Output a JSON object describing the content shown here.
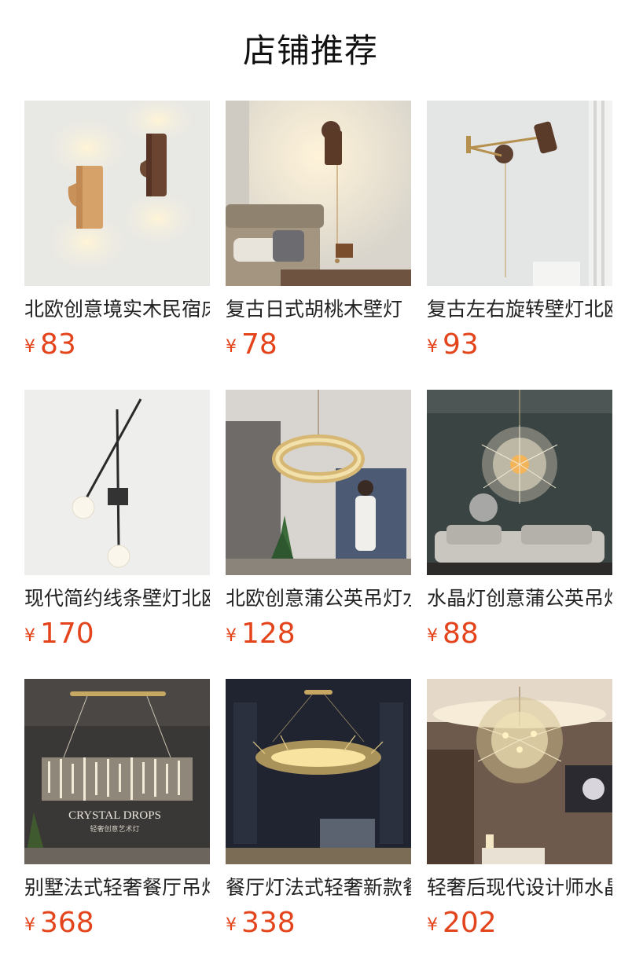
{
  "page": {
    "title": "店铺推荐"
  },
  "currency_symbol": "¥",
  "colors": {
    "price": "#e4441b",
    "title": "#111111",
    "text": "#222222"
  },
  "products": [
    {
      "title": "北欧创意境实木民宿床头壁灯",
      "price": "83",
      "image": "wood-cylinder-wall-lamps"
    },
    {
      "title": "复古日式胡桃木壁灯",
      "price": "78",
      "image": "walnut-pull-chain-wall-lamp"
    },
    {
      "title": "复古左右旋转壁灯北欧",
      "price": "93",
      "image": "swing-arm-wall-lamp"
    },
    {
      "title": "现代简约线条壁灯北欧",
      "price": "170",
      "image": "line-globe-wall-lamp"
    },
    {
      "title": "北欧创意蒲公英吊灯水晶",
      "price": "128",
      "image": "crystal-ring-chandelier"
    },
    {
      "title": "水晶灯创意蒲公英吊灯",
      "price": "88",
      "image": "dandelion-crystal-chandelier"
    },
    {
      "title": "别墅法式轻奢餐厅吊灯",
      "price": "368",
      "image": "crystal-drops-chandelier"
    },
    {
      "title": "餐厅灯法式轻奢新款餐厅",
      "price": "338",
      "image": "gold-branch-chandelier"
    },
    {
      "title": "轻奢后现代设计师水晶吊灯",
      "price": "202",
      "image": "round-crystal-chandelier"
    }
  ],
  "image_captions": {
    "crystal_drops_title": "CRYSTAL DROPS",
    "crystal_drops_subtitle": "轻奢创意艺术灯"
  }
}
